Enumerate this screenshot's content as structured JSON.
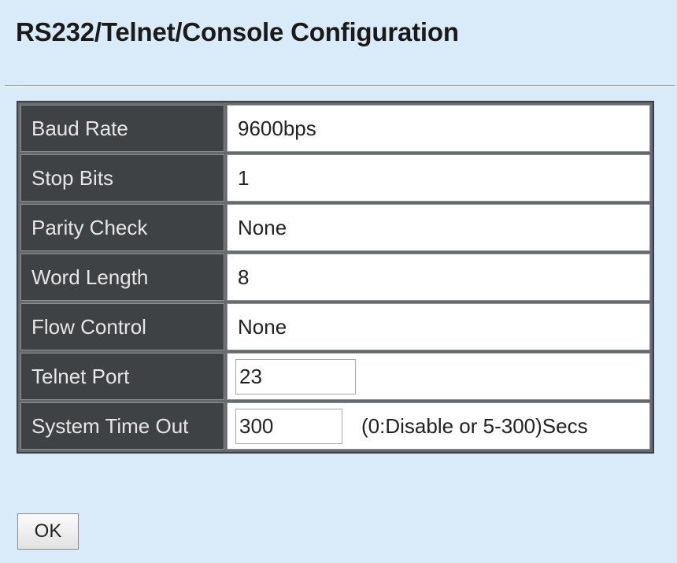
{
  "page": {
    "title": "RS232/Telnet/Console Configuration"
  },
  "settings": {
    "baud_rate": {
      "label": "Baud Rate",
      "value": "9600bps"
    },
    "stop_bits": {
      "label": "Stop Bits",
      "value": "1"
    },
    "parity_check": {
      "label": "Parity Check",
      "value": "None"
    },
    "word_length": {
      "label": "Word Length",
      "value": "8"
    },
    "flow_control": {
      "label": "Flow Control",
      "value": "None"
    },
    "telnet_port": {
      "label": "Telnet Port",
      "value": "23"
    },
    "system_time_out": {
      "label": "System Time Out",
      "value": "300",
      "hint": "(0:Disable or 5-300)Secs"
    }
  },
  "actions": {
    "ok_label": "OK"
  },
  "colors": {
    "page_background": "#d9eaf9",
    "label_cell_background": "#3f4245",
    "label_text": "#e6e6e6",
    "value_cell_background": "#ffffff"
  }
}
